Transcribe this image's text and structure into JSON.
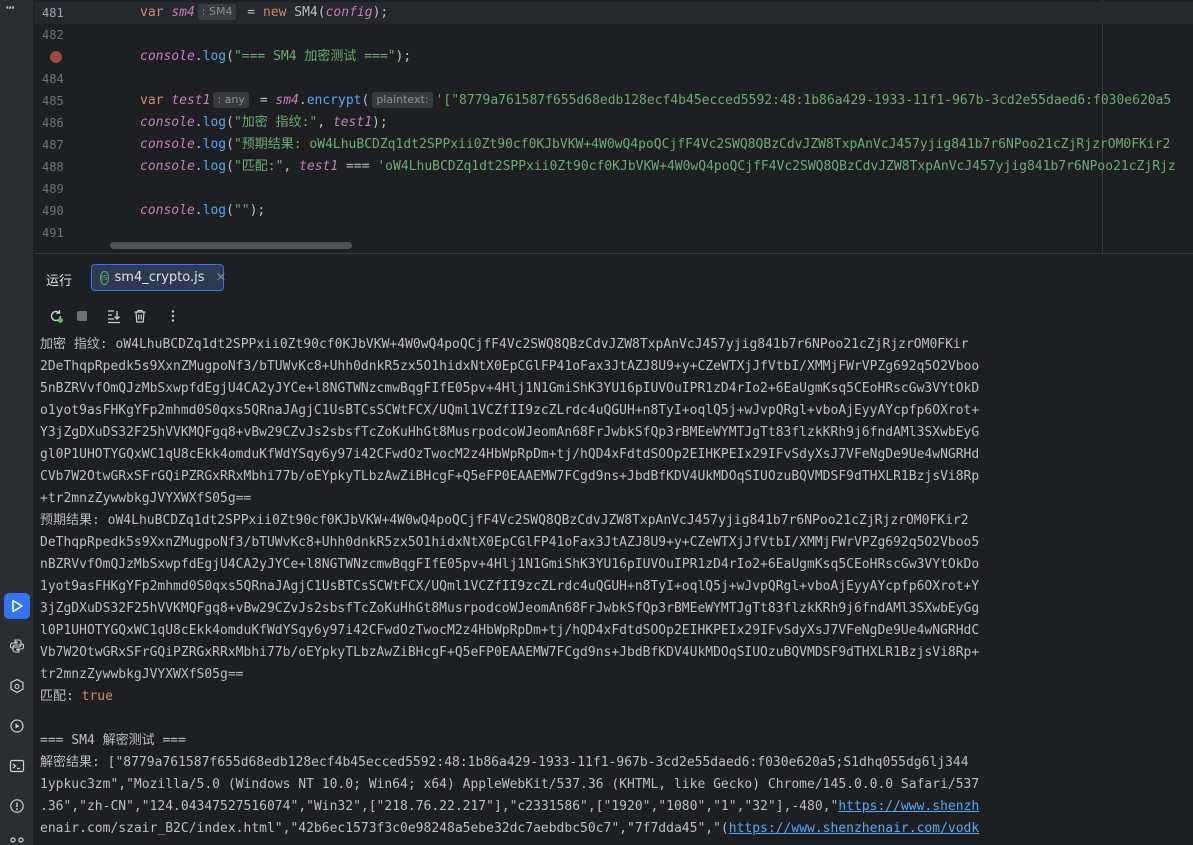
{
  "editor": {
    "lines": [
      {
        "num": "481",
        "kw": "var",
        "var": "sm4",
        "hint": ": SM4",
        "eq": " = ",
        "kw2": "new",
        "rest": " SM4(",
        "arg": "config",
        "end": ");"
      },
      {
        "num": "482"
      },
      {
        "num": "483",
        "obj": "console",
        "dot": ".",
        "fn": "log",
        "open": "(",
        "str": "\"=== SM4 加密测试 ===\"",
        "end": ");"
      },
      {
        "num": "484"
      },
      {
        "num": "485",
        "kw": "var",
        "var": "test1",
        "hint": ": any",
        "eq": " = ",
        "obj": "sm4",
        "dot": ".",
        "fn": "encrypt",
        "open": "(",
        "hint2": "plaintext:",
        "str": "'[\"8779a761587f655d68edb128ecf4b45ecced5592:48:1b86a429-1933-11f1-967b-3cd2e55daed6:f030e620a5"
      },
      {
        "num": "486",
        "obj": "console",
        "dot": ".",
        "fn": "log",
        "open": "(",
        "str": "\"加密 指纹:\"",
        "sep": ", ",
        "arg": "test1",
        "end": ");"
      },
      {
        "num": "487",
        "obj": "console",
        "dot": ".",
        "fn": "log",
        "open": "(",
        "str": "\"预期结果: oW4LhuBCDZq1dt2SPPxii0Zt90cf0KJbVKW+4W0wQ4poQCjfF4Vc2SWQ8QBzCdvJZW8TxpAnVcJ457yjig841b7r6NPoo21cZjRjzrOM0FKir2"
      },
      {
        "num": "488",
        "obj": "console",
        "dot": ".",
        "fn": "log",
        "open": "(",
        "str": "\"匹配:\"",
        "sep": ", ",
        "arg": "test1",
        "op": " === ",
        "str2": "'oW4LhuBCDZq1dt2SPPxii0Zt90cf0KJbVKW+4W0wQ4poQCjfF4Vc2SWQ8QBzCdvJZW8TxpAnVcJ457yjig841b7r6NPoo21cZjRjz"
      },
      {
        "num": "489"
      },
      {
        "num": "490",
        "obj": "console",
        "dot": ".",
        "fn": "log",
        "open": "(",
        "str": "\"\"",
        "end": ");"
      },
      {
        "num": "491"
      }
    ]
  },
  "run": {
    "label": "运行",
    "tab_name": "sm4_crypto.js",
    "tab_icon_text": "JS",
    "close_glyph": "×"
  },
  "console": {
    "lines": [
      "加密 指纹: oW4LhuBCDZq1dt2SPPxii0Zt90cf0KJbVKW+4W0wQ4poQCjfF4Vc2SWQ8QBzCdvJZW8TxpAnVcJ457yjig841b7r6NPoo21cZjRjzrOM0FKir",
      "2DeThqpRpedk5s9XxnZMugpoNf3/bTUWvKc8+Uhh0dnkR5zx5O1hidxNtX0EpCGlFP41oFax3JtAZJ8U9+y+CZeWTXjJfVtbI/XMMjFWrVPZg692q5O2Vboo",
      "5nBZRVvfOmQJzMbSxwpfdEgjU4CA2yJYCe+l8NGTWNzcmwBqgFIfE05pv+4Hlj1N1GmiShK3YU16pIUVOuIPR1zD4rIo2+6EaUgmKsq5CEoHRscGw3VYtOkD",
      "o1yot9asFHKgYFp2mhmd0S0qxs5QRnaJAgjC1UsBTCsSCWtFCX/UQml1VCZfII9zcZLrdc4uQGUH+n8TyI+oqlQ5j+wJvpQRgl+vboAjEyyAYcpfp6OXrot+",
      "Y3jZgDXuDS32F25hVVKMQFgq8+vBw29CZvJs2sbsfTcZoKuHhGt8MusrpodcoWJeomAn68FrJwbkSfQp3rBMEeWYMTJgTt83flzkKRh9j6fndAMl3SXwbEyG",
      "gl0P1UHOTYGQxWC1qU8cEkk4omduKfWdYSqy6y97i42CFwdOzTwocM2z4HbWpRpDm+tj/hQD4xFdtdSOOp2EIHKPEIx29IFvSdyXsJ7VFeNgDe9Ue4wNGRHd",
      "CVb7W2OtwGRxSFrGQiPZRGxRRxMbhi77b/oEYpkyTLbzAwZiBHcgF+Q5eFP0EAAEMW7FCgd9ns+JbdBfKDV4UkMDOqSIUOzuBQVMDSF9dTHXLR1BzjsVi8Rp",
      "+tr2mnzZywwbkgJVYXWXfS05g==",
      "预期结果: oW4LhuBCDZq1dt2SPPxii0Zt90cf0KJbVKW+4W0wQ4poQCjfF4Vc2SWQ8QBzCdvJZW8TxpAnVcJ457yjig841b7r6NPoo21cZjRjzrOM0FKir2",
      "DeThqpRpedk5s9XxnZMugpoNf3/bTUWvKc8+Uhh0dnkR5zx5O1hidxNtX0EpCGlFP41oFax3JtAZJ8U9+y+CZeWTXjJfVtbI/XMMjFWrVPZg692q5O2Vboo5",
      "nBZRVvfOmQJzMbSxwpfdEgjU4CA2yJYCe+l8NGTWNzcmwBqgFIfE05pv+4Hlj1N1GmiShK3YU16pIUVOuIPR1zD4rIo2+6EaUgmKsq5CEoHRscGw3VYtOkDo",
      "1yot9asFHKgYFp2mhmd0S0qxs5QRnaJAgjC1UsBTCsSCWtFCX/UQml1VCZfII9zcZLrdc4uQGUH+n8TyI+oqlQ5j+wJvpQRgl+vboAjEyyAYcpfp6OXrot+Y",
      "3jZgDXuDS32F25hVVKMQFgq8+vBw29CZvJs2sbsfTcZoKuHhGt8MusrpodcoWJeomAn68FrJwbkSfQp3rBMEeWYMTJgTt83flzkKRh9j6fndAMl3SXwbEyGg",
      "l0P1UHOTYGQxWC1qU8cEkk4omduKfWdYSqy6y97i42CFwdOzTwocM2z4HbWpRpDm+tj/hQD4xFdtdSOOp2EIHKPEIx29IFvSdyXsJ7VFeNgDe9Ue4wNGRHdC",
      "Vb7W2OtwGRxSFrGQiPZRGxRRxMbhi77b/oEYpkyTLbzAwZiBHcgF+Q5eFP0EAAEMW7FCgd9ns+JbdBfKDV4UkMDOqSIUOzuBQVMDSF9dTHXLR1BzjsVi8Rp+",
      "tr2mnzZywwbkgJVYXWXfS05g==",
      "匹配: ",
      "",
      "=== SM4 解密测试 ===",
      "解密结果: [\"8779a761587f655d68edb128ecf4b45ecced5592:48:1b86a429-1933-11f1-967b-3cd2e55daed6:f030e620a5;S1dhq055dg6lj344",
      "1ypkuc3zm\",\"Mozilla/5.0 (Windows NT 10.0; Win64; x64) AppleWebKit/537.36 (KHTML, like Gecko) Chrome/145.0.0.0 Safari/537",
      ".36\",\"zh-CN\",\"124.04347527516074\",\"Win32\",[\"218.76.22.217\"],\"c2331586\",[\"1920\",\"1080\",\"1\",\"32\"],-480,\"",
      "enair.com/szair_B2C/index.html\",\"42b6ec1573f3c0e98248a5ebe32dc7aebdbc50c7\",\"7f7dda45\",\"("
    ],
    "match_value": "true",
    "link1": "https://www.shenzh",
    "link2": "https://www.shenzhenair.com/vodk"
  }
}
